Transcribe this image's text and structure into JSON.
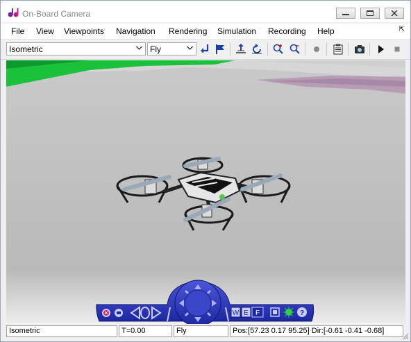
{
  "window": {
    "title": "On-Board Camera"
  },
  "menu": [
    "File",
    "View",
    "Viewpoints",
    "Navigation",
    "Rendering",
    "Simulation",
    "Recording",
    "Help"
  ],
  "toolbar": {
    "viewpoint_select": "Isometric",
    "navigation_select": "Fly"
  },
  "nav_panel": {
    "button_w": "W",
    "button_e": "E",
    "button_f": "F"
  },
  "status": {
    "viewpoint": "Isometric",
    "time": "T=0.00",
    "mode": "Fly",
    "position": "Pos:[57.23 0.17 95.25] Dir:[-0.61 -0.41 -0.68]"
  }
}
